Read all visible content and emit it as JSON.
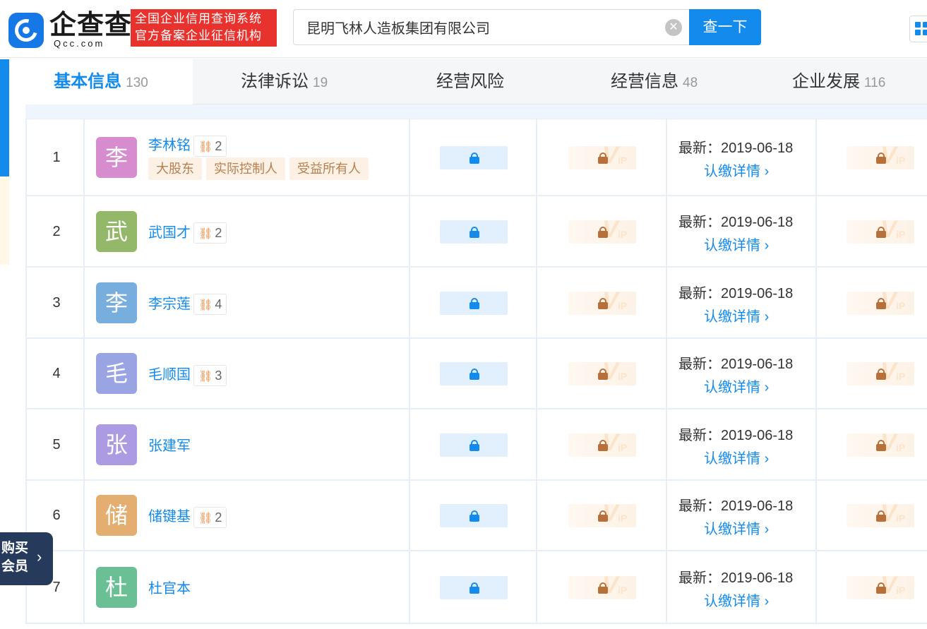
{
  "header": {
    "logo_text": "企查查",
    "logo_sub": "Qcc.com",
    "slogan_line1": "全国企业信用查询系统",
    "slogan_line2": "官方备案企业征信机构",
    "search_value": "昆明飞林人造板集团有限公司",
    "search_button": "查一下"
  },
  "tabs": [
    {
      "label": "基本信息",
      "count": "130",
      "active": true
    },
    {
      "label": "法律诉讼",
      "count": "19",
      "active": false
    },
    {
      "label": "经营风险",
      "count": "",
      "active": false
    },
    {
      "label": "经营信息",
      "count": "48",
      "active": false
    },
    {
      "label": "企业发展",
      "count": "116",
      "active": false
    }
  ],
  "table": {
    "latest_prefix": "最新：",
    "detail_label": "认缴详情",
    "rows": [
      {
        "index": "1",
        "name": "李林铭",
        "avatar_char": "李",
        "avatar_color": "#d68ccf",
        "relations": "2",
        "tags": [
          "大股东",
          "实际控制人",
          "受益所有人"
        ],
        "latest_date": "2019-06-18"
      },
      {
        "index": "2",
        "name": "武国才",
        "avatar_char": "武",
        "avatar_color": "#94b86a",
        "relations": "2",
        "tags": [],
        "latest_date": "2019-06-18"
      },
      {
        "index": "3",
        "name": "李宗莲",
        "avatar_char": "李",
        "avatar_color": "#78aedd",
        "relations": "4",
        "tags": [],
        "latest_date": "2019-06-18"
      },
      {
        "index": "4",
        "name": "毛顺国",
        "avatar_char": "毛",
        "avatar_color": "#9aa4e3",
        "relations": "3",
        "tags": [],
        "latest_date": "2019-06-18"
      },
      {
        "index": "5",
        "name": "张建军",
        "avatar_char": "张",
        "avatar_color": "#ac9ae3",
        "relations": "",
        "tags": [],
        "latest_date": "2019-06-18"
      },
      {
        "index": "6",
        "name": "储键基",
        "avatar_char": "储",
        "avatar_color": "#e3ae70",
        "relations": "2",
        "tags": [],
        "latest_date": "2019-06-18"
      },
      {
        "index": "7",
        "name": "杜官本",
        "avatar_char": "杜",
        "avatar_color": "#6bbf94",
        "relations": "",
        "tags": [],
        "latest_date": "2019-06-18"
      }
    ]
  },
  "member_button": {
    "line1": "购买",
    "line2": "会员"
  },
  "colors": {
    "accent": "#128bed",
    "slogan_bg": "#e8322d",
    "member_bg": "#263a5c"
  }
}
